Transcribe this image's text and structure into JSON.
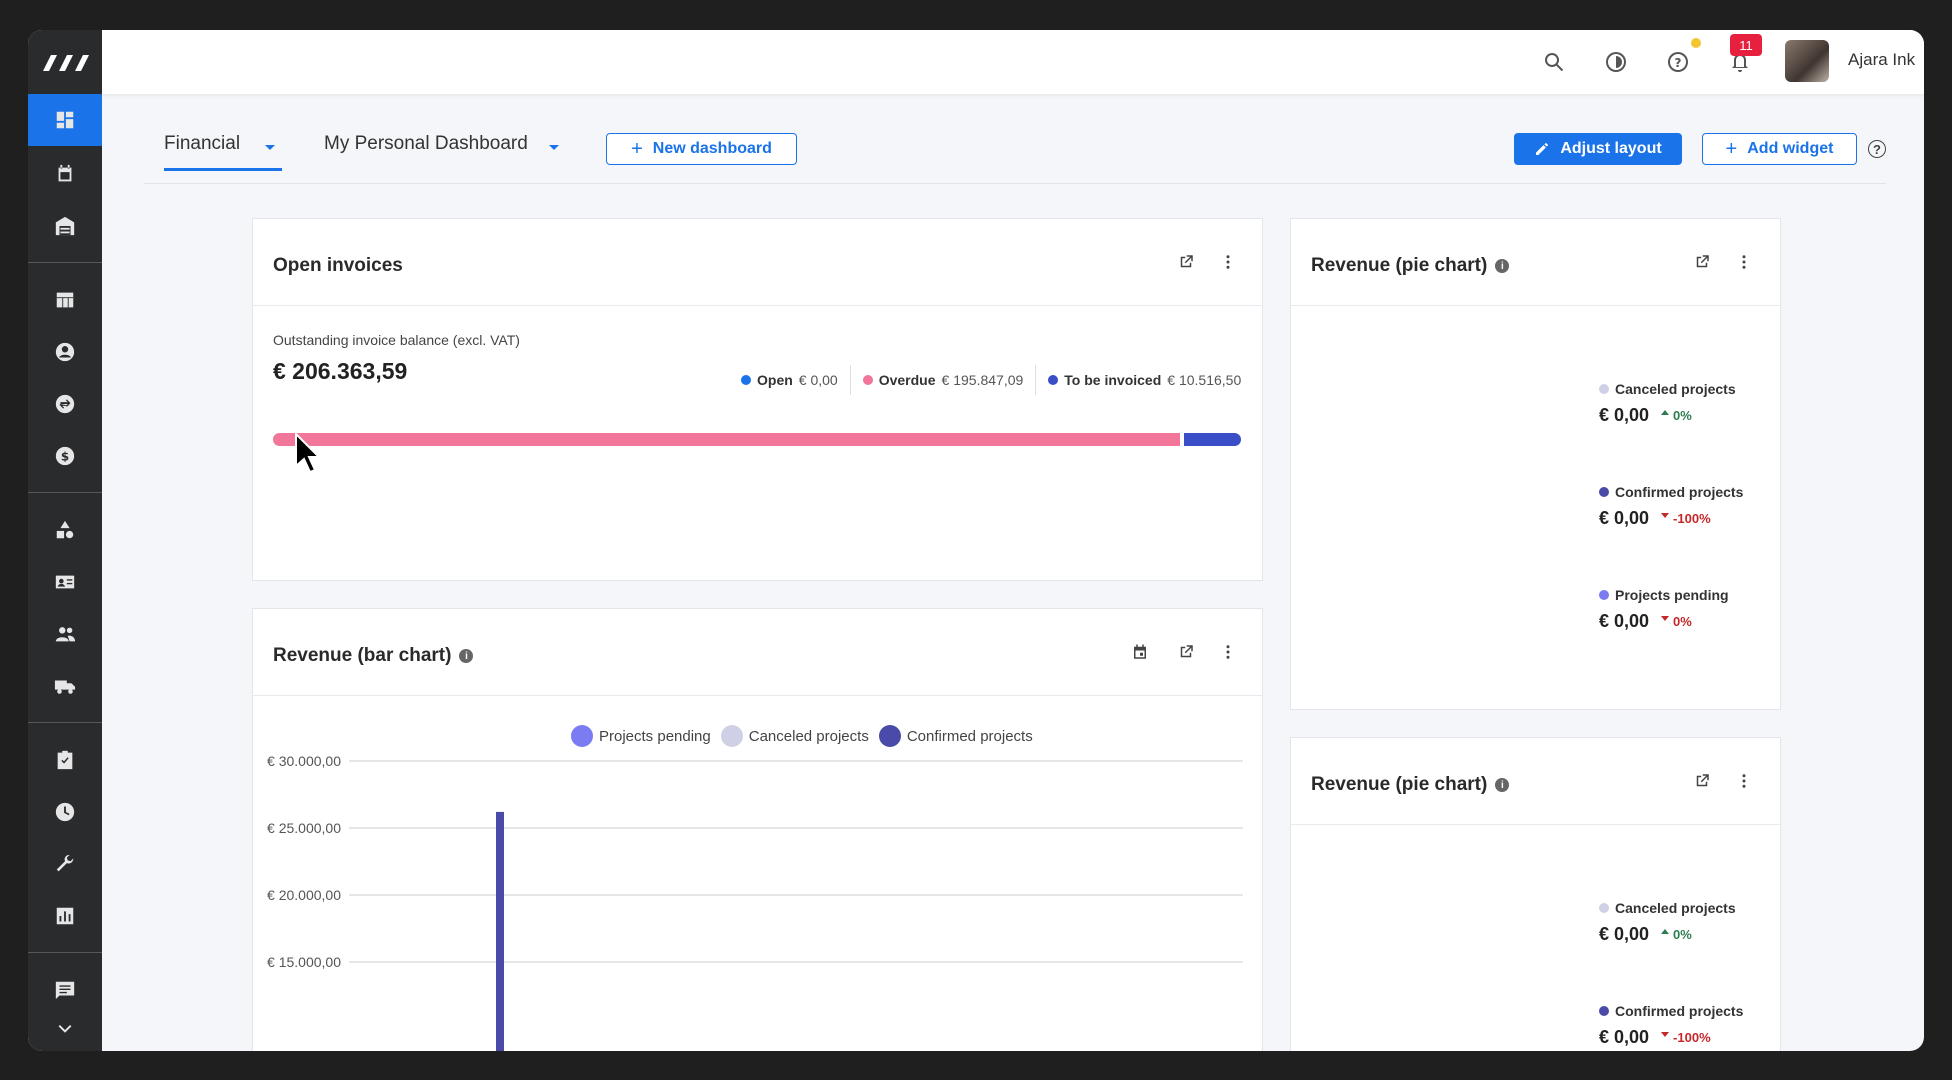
{
  "header": {
    "user_name": "Ajara Ink",
    "notification_count": "11"
  },
  "tabs": [
    {
      "label": "Financial",
      "active": true
    },
    {
      "label": "My Personal Dashboard",
      "active": false
    }
  ],
  "toolbar": {
    "new_dashboard": "New dashboard",
    "adjust_layout": "Adjust layout",
    "add_widget": "Add widget",
    "help": "?"
  },
  "colors": {
    "accent": "#1a73e8",
    "open": "#1a73e8",
    "overdue": "#f2769a",
    "to_be_invoiced": "#3a4fc7",
    "projects_pending": "#7b7bf2",
    "canceled_projects": "#cfd0e6",
    "confirmed_projects": "#4a4aa8"
  },
  "open_invoices": {
    "title": "Open invoices",
    "balance_label": "Outstanding invoice balance (excl. VAT)",
    "total": "€ 206.363,59",
    "legend": [
      {
        "name": "Open",
        "value": "€ 0,00"
      },
      {
        "name": "Overdue",
        "value": "€ 195.847,09"
      },
      {
        "name": "To be invoiced",
        "value": "€ 10.516,50"
      }
    ]
  },
  "bar_chart_card": {
    "title": "Revenue (bar chart)"
  },
  "chart_data": {
    "type": "bar",
    "series": [
      {
        "name": "Projects pending",
        "values": [
          0
        ]
      },
      {
        "name": "Canceled projects",
        "values": [
          0
        ]
      },
      {
        "name": "Confirmed projects",
        "values": [
          26200
        ]
      }
    ],
    "categories": [
      ""
    ],
    "y_ticks": [
      "€ 30.000,00",
      "€ 25.000,00",
      "€ 20.000,00",
      "€ 15.000,00"
    ],
    "y_tick_values": [
      30000,
      25000,
      20000,
      15000
    ],
    "legend_position": "top-center",
    "grid": true
  },
  "pie_cards": [
    {
      "title": "Revenue (pie chart)",
      "items": [
        {
          "name": "Canceled projects",
          "value": "€ 0,00",
          "change": "0%",
          "direction": "up"
        },
        {
          "name": "Confirmed projects",
          "value": "€ 0,00",
          "change": "-100%",
          "direction": "down"
        },
        {
          "name": "Projects pending",
          "value": "€ 0,00",
          "change": "0%",
          "direction": "down"
        }
      ]
    },
    {
      "title": "Revenue (pie chart)",
      "items": [
        {
          "name": "Canceled projects",
          "value": "€ 0,00",
          "change": "0%",
          "direction": "up"
        },
        {
          "name": "Confirmed projects",
          "value": "€ 0,00",
          "change": "-100%",
          "direction": "down"
        }
      ]
    }
  ]
}
